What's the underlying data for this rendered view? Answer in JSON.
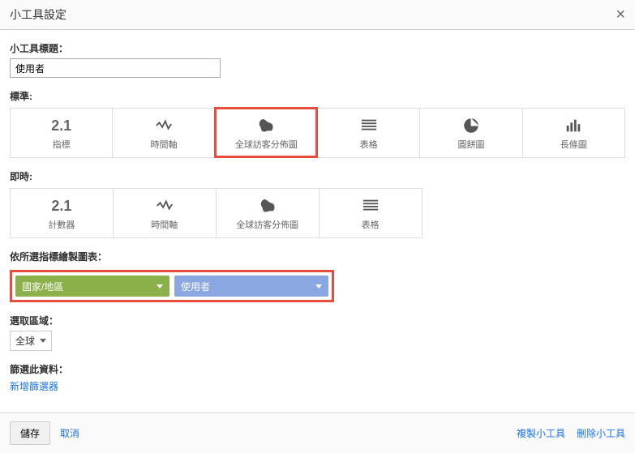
{
  "header": {
    "title": "小工具設定"
  },
  "title_field": {
    "label": "小工具標題：",
    "value": "使用者"
  },
  "standard": {
    "label": "標準:",
    "tiles": {
      "metric": {
        "icon_text": "2.1",
        "label": "指標"
      },
      "timeline": {
        "label": "時間軸"
      },
      "geomap": {
        "label": "全球訪客分佈圖"
      },
      "table": {
        "label": "表格"
      },
      "pie": {
        "label": "圓餅圖"
      },
      "bar": {
        "label": "長條圖"
      }
    }
  },
  "realtime": {
    "label": "即時:",
    "tiles": {
      "counter": {
        "icon_text": "2.1",
        "label": "計數器"
      },
      "timeline": {
        "label": "時間軸"
      },
      "geomap": {
        "label": "全球訪客分佈圖"
      },
      "table": {
        "label": "表格"
      }
    }
  },
  "dim_metric": {
    "label": "依所選指標繪製圖表：",
    "dimension": "國家/地區",
    "metric": "使用者"
  },
  "region": {
    "label": "選取區域：",
    "value": "全球"
  },
  "filter": {
    "label": "篩選此資料：",
    "add_link": "新增篩選器"
  },
  "footer": {
    "save": "儲存",
    "cancel": "取消",
    "copy": "複製小工具",
    "delete": "刪除小工具"
  }
}
